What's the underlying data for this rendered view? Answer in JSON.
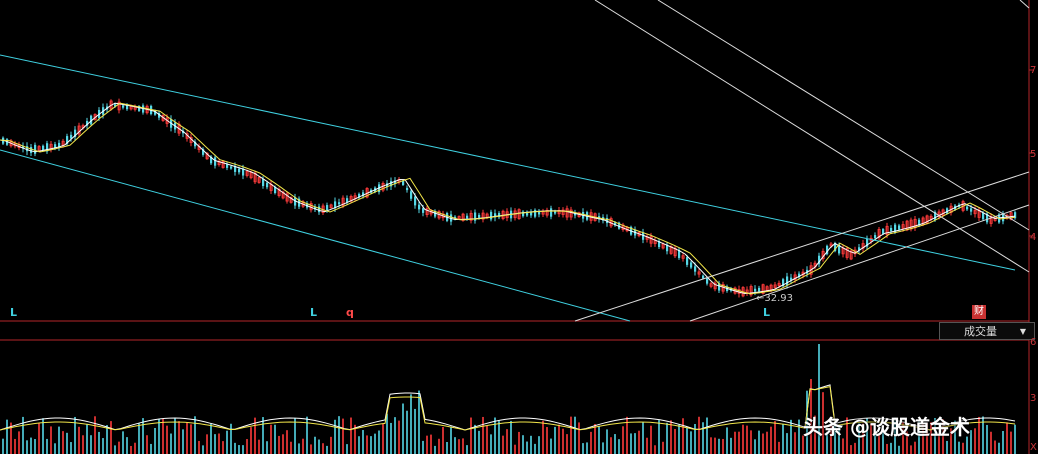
{
  "markers": {
    "l1": "L",
    "l2": "L",
    "q": "q",
    "l3": "L",
    "cai": "财"
  },
  "low_price_label": "32.93",
  "volume_selector": {
    "label": "成交量",
    "arrow": "▼"
  },
  "price_axis_ticks": [
    "7",
    "5",
    "4"
  ],
  "volume_axis_ticks": [
    "6",
    "3",
    "X"
  ],
  "watermark": "头条 @谈股道金术",
  "colors": {
    "up": "#ff3b3b",
    "down": "#56d7e6",
    "ma_short": "#ffffff",
    "ma_long": "#f2e64a",
    "channel_cyan": "#3fd0e0",
    "channel_white": "#dddddd",
    "axis": "#c8363a"
  }
}
